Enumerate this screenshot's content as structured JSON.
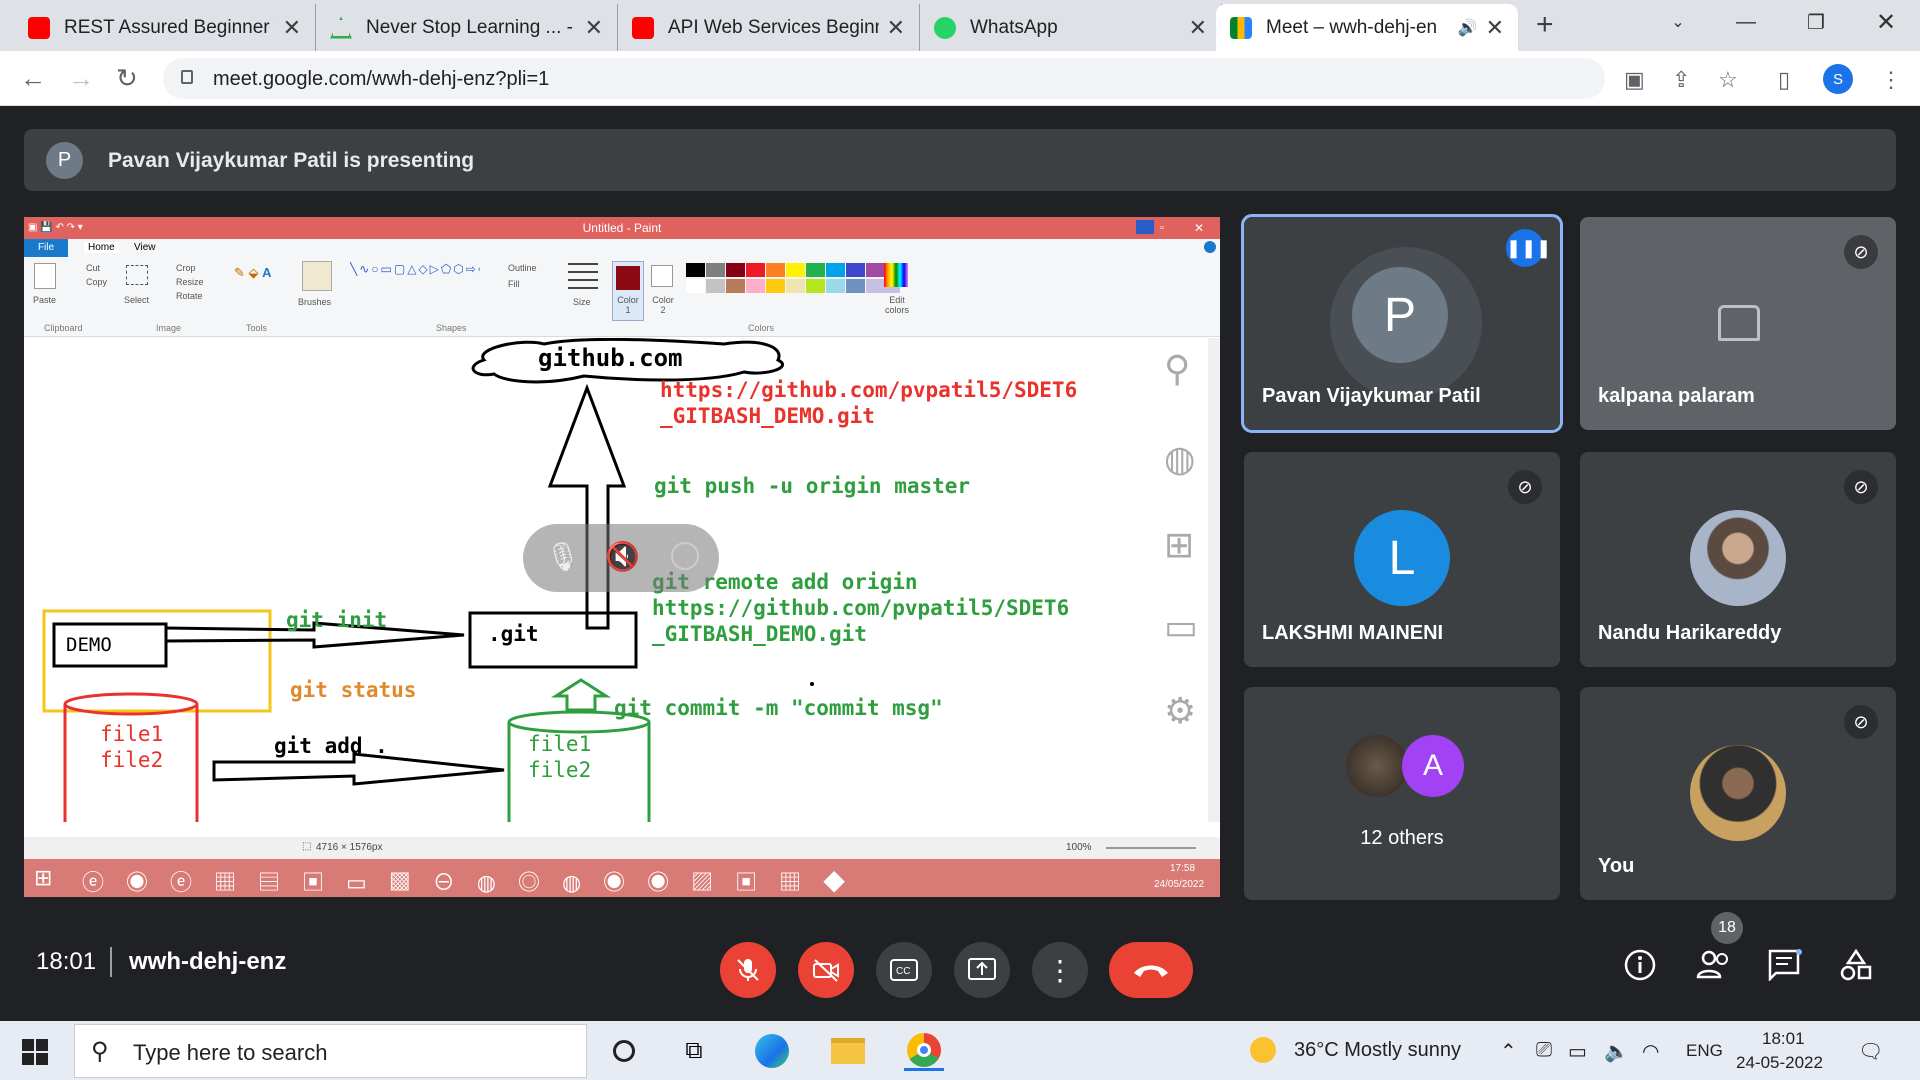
{
  "browser": {
    "tabs": [
      {
        "title": "REST Assured Beginner Tu",
        "favicon": "youtube-icon",
        "color": "#ff0000"
      },
      {
        "title": "Never Stop Learning ... - A",
        "favicon": "app-icon",
        "color": "#34a853"
      },
      {
        "title": "API Web Services Beginne",
        "favicon": "youtube-icon",
        "color": "#ff0000"
      },
      {
        "title": "WhatsApp",
        "favicon": "whatsapp-icon",
        "color": "#25d366"
      },
      {
        "title": "Meet – wwh-dehj-en",
        "favicon": "meet-icon",
        "color": "#00832d"
      }
    ],
    "url": "meet.google.com/wwh-dehj-enz?pli=1",
    "profile_initial": "S"
  },
  "meet": {
    "presenter_initial": "P",
    "presenting_text": "Pavan Vijaykumar Patil is presenting",
    "time": "18:01",
    "meeting_code": "wwh-dehj-enz",
    "participant_count": "18",
    "tiles": [
      {
        "name": "Pavan Vijaykumar Patil",
        "initial": "P",
        "speaking": true
      },
      {
        "name": "kalpana palaram",
        "initial": "",
        "muted": true
      },
      {
        "name": "LAKSHMI MAINENI",
        "initial": "L",
        "muted": true
      },
      {
        "name": "Nandu Harikareddy",
        "initial": "",
        "muted": true
      },
      {
        "name": "12 others",
        "initial": "A"
      },
      {
        "name": "You",
        "initial": "",
        "muted": true
      }
    ]
  },
  "paint": {
    "title": "Untitled - Paint",
    "menu": {
      "file": "File",
      "home": "Home",
      "view": "View"
    },
    "ribbon": {
      "clipboard": "Clipboard",
      "image": "Image",
      "tools": "Tools",
      "shapes": "Shapes",
      "colors": "Colors",
      "paste": "Paste",
      "cut": "Cut",
      "copy": "Copy",
      "select": "Select",
      "crop": "Crop",
      "resize": "Resize",
      "rotate": "Rotate",
      "brushes": "Brushes",
      "outline": "Outline",
      "fill": "Fill",
      "size": "Size",
      "color1": "Color 1",
      "color2": "Color 2",
      "edit_colors": "Edit colors"
    },
    "status": {
      "dims": "4716 × 1576px",
      "zoom": "100%"
    },
    "taskbar_time": "17:58",
    "taskbar_date": "24/05/2022",
    "drawing": {
      "cloud": "github.com",
      "url_red_1": "https://github.com/pvpatil5/SDET6",
      "url_red_2": "_GITBASH_DEMO.git",
      "push": "git push -u origin master",
      "remote_1": "git remote add origin",
      "remote_2": "https://github.com/pvpatil5/SDET6",
      "remote_3": "_GITBASH_DEMO.git",
      "init": "git init",
      "demo": "DEMO",
      "dotgit": ".git",
      "status": "git status",
      "commit": "git commit -m \"commit msg\"",
      "add": "git add .",
      "file1": "file1",
      "file2": "file2",
      "file1b": "file1",
      "file2b": "file2"
    }
  },
  "windows": {
    "search_placeholder": "Type here to search",
    "weather": "36°C  Mostly sunny",
    "lang": "ENG",
    "time": "18:01",
    "date": "24-05-2022"
  }
}
